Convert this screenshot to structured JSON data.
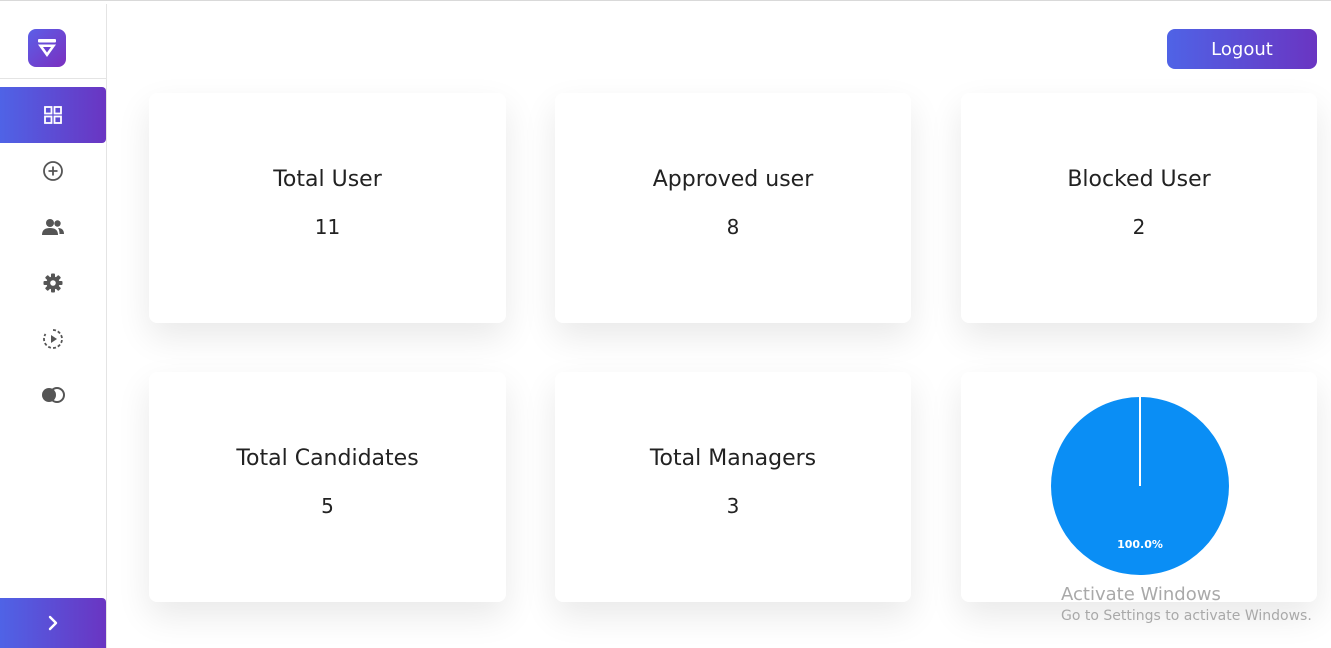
{
  "app": {
    "logo_icon": "shield-logo-icon"
  },
  "sidebar": {
    "items": [
      {
        "icon": "dashboard-grid-icon",
        "active": true
      },
      {
        "icon": "add-circle-icon",
        "active": false
      },
      {
        "icon": "users-icon",
        "active": false
      },
      {
        "icon": "gear-icon",
        "active": false
      },
      {
        "icon": "play-cycle-icon",
        "active": false
      },
      {
        "icon": "toggle-circles-icon",
        "active": false
      }
    ],
    "expand_icon": "chevron-right-icon"
  },
  "header": {
    "logout_label": "Logout"
  },
  "cards": [
    {
      "title": "Total User",
      "value": "11"
    },
    {
      "title": "Approved user",
      "value": "8"
    },
    {
      "title": "Blocked User",
      "value": "2"
    },
    {
      "title": "Total Candidates",
      "value": "5"
    },
    {
      "title": "Total Managers",
      "value": "3"
    }
  ],
  "chart_data": {
    "type": "pie",
    "slices": [
      {
        "value": 100.0,
        "label": "100.0%",
        "color": "#0a8ef5"
      }
    ]
  },
  "watermark": {
    "title": "Activate Windows",
    "subtitle": "Go to Settings to activate Windows."
  },
  "colors": {
    "accent_start": "#4f63e6",
    "accent_end": "#6a35c2",
    "pie": "#0a8ef5"
  }
}
